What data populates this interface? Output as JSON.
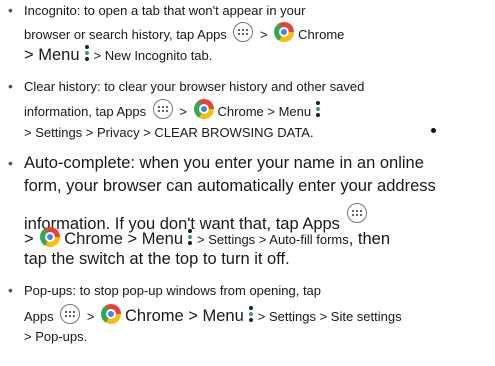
{
  "bullet_char": "•",
  "items": [
    {
      "lines": [
        {
          "a": "Incognito: to open a tab that won't appear in your"
        },
        {
          "a": "browser or search history, tap Apps",
          "b": ">",
          "c": "Chrome"
        },
        {
          "a": "> Menu",
          "b": "> New Incognito tab."
        }
      ]
    },
    {
      "lines": [
        {
          "a": "Clear history: to clear your browser history and other saved"
        },
        {
          "a": "information, tap Apps",
          "b": ">",
          "c": "Chrome > Menu"
        },
        {
          "a": "> Settings > Privacy > CLEAR BROWSING DATA."
        }
      ]
    },
    {
      "lines": [
        {
          "a": "Auto-complete: when you enter your name in an online"
        },
        {
          "a": "form, your browser can automatically enter your address"
        },
        {
          "a": "information. If you don't want that, tap Apps"
        },
        {
          "a": ">",
          "b": "Chrome > Menu",
          "c": "> Settings > Auto-fill forms",
          "d": ", then"
        },
        {
          "a": "tap the switch at the top to turn it off."
        }
      ]
    },
    {
      "lines": [
        {
          "a": "Pop-ups: to stop pop-up windows from opening, tap"
        },
        {
          "a": "Apps",
          "b": ">",
          "c": "Chrome > Menu",
          "d": "> Settings > Site settings"
        },
        {
          "a": "> Pop-ups."
        }
      ]
    }
  ],
  "icons": {
    "apps": "apps-icon",
    "chrome": "chrome-icon",
    "menu": "menu-icon"
  }
}
